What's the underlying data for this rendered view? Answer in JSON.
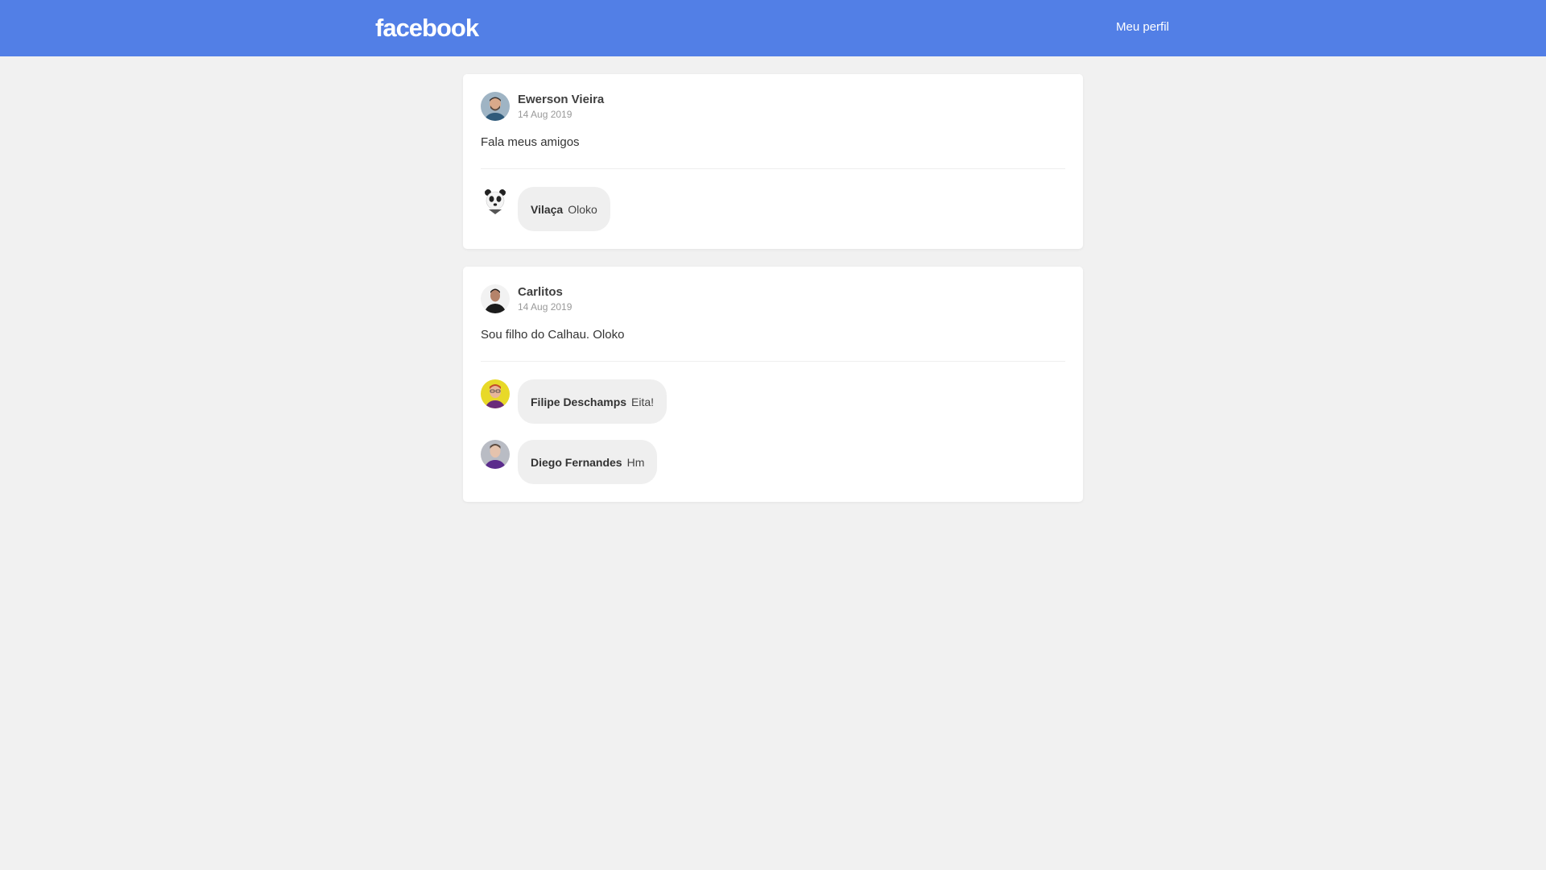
{
  "header": {
    "logo": "facebook",
    "profile_link": "Meu perfil"
  },
  "posts": [
    {
      "author": "Ewerson Vieira",
      "date": "14 Aug 2019",
      "content": "Fala meus amigos",
      "comments": [
        {
          "author": "Vilaça",
          "content": "Oloko"
        }
      ]
    },
    {
      "author": "Carlitos",
      "date": "14 Aug 2019",
      "content": "Sou filho do Calhau. Oloko",
      "comments": [
        {
          "author": "Filipe Deschamps",
          "content": "Eita!"
        },
        {
          "author": "Diego Fernandes",
          "content": "Hm"
        }
      ]
    }
  ],
  "colors": {
    "brand": "#527fe6",
    "background": "#f1f1f1",
    "bubble": "#efefef"
  }
}
